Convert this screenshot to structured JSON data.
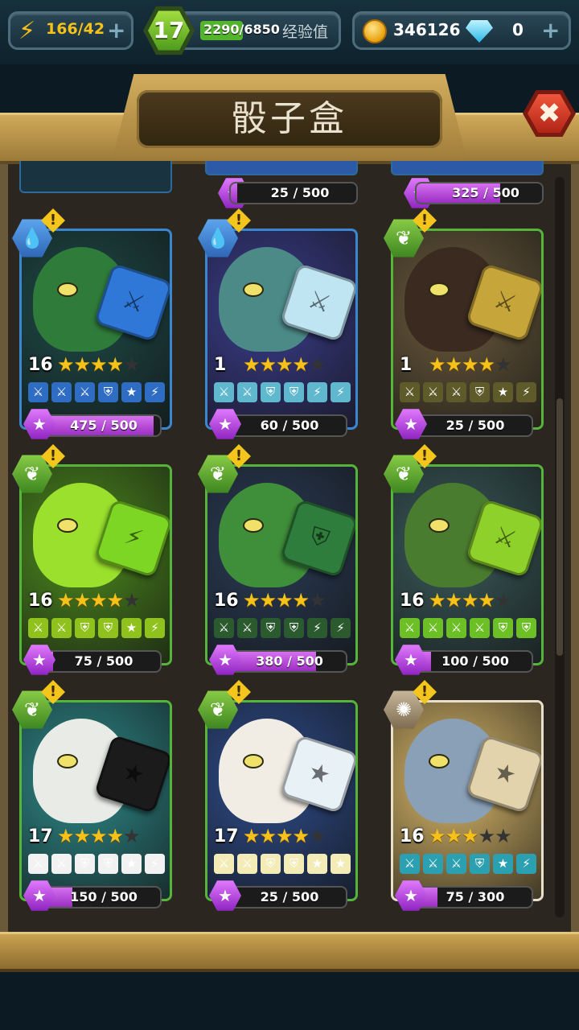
{
  "header": {
    "energy": "166/42",
    "level": "17",
    "xp": "2290/6850",
    "xp_progress": 0.33,
    "xp_label": "经验值",
    "coins": "346126",
    "gems": "0",
    "plus_label": "+"
  },
  "title": "骰子盒",
  "close_label": "✖",
  "partial_row": [
    {
      "progress": "25 / 500"
    },
    {
      "progress": "325 / 500"
    }
  ],
  "cards": [
    {
      "element": "water",
      "element_icon": "💧",
      "level": "16",
      "stars": 4,
      "progress": "475 / 500",
      "progress_ratio": 0.95,
      "bg": "#1d4a48",
      "creature": "#2f7c3a",
      "die": "#2f78d8",
      "die_face": "⚔",
      "face_color": "#2f6cc4",
      "faces": [
        "⚔",
        "⚔",
        "⚔",
        "⛨",
        "★",
        "⚡"
      ]
    },
    {
      "element": "water",
      "element_icon": "💧",
      "level": "1",
      "stars": 4,
      "progress": "60 / 500",
      "progress_ratio": 0.12,
      "bg": "#3a3d8c",
      "creature": "#4c8a88",
      "die": "#bfe4f2",
      "die_face": "⚔",
      "face_color": "#60b8cf",
      "faces": [
        "⚔",
        "⚔",
        "⛨",
        "⛨",
        "⚡",
        "⚡"
      ]
    },
    {
      "element": "nature",
      "element_icon": "❦",
      "level": "1",
      "stars": 4,
      "progress": "25 / 500",
      "progress_ratio": 0.05,
      "bg": "#6a5a3c",
      "creature": "#3a2a20",
      "die": "#c6a53a",
      "die_face": "⚔",
      "face_color": "#5f5a2a",
      "faces": [
        "⚔",
        "⚔",
        "⚔",
        "⛨",
        "★",
        "⚡"
      ]
    },
    {
      "element": "nature",
      "element_icon": "❦",
      "level": "16",
      "stars": 4,
      "progress": "75 / 500",
      "progress_ratio": 0.15,
      "bg": "#4c8a1e",
      "creature": "#9ae02c",
      "die": "#7ed624",
      "die_face": "⚡",
      "face_color": "#8fc21c",
      "faces": [
        "⚔",
        "⚔",
        "⛨",
        "⛨",
        "★",
        "⚡"
      ]
    },
    {
      "element": "nature",
      "element_icon": "❦",
      "level": "16",
      "stars": 4,
      "progress": "380 / 500",
      "progress_ratio": 0.76,
      "bg": "#2a3c56",
      "creature": "#3f8f3a",
      "die": "#2f7d3c",
      "die_face": "⛨",
      "face_color": "#2a5a2e",
      "faces": [
        "⚔",
        "⚔",
        "⛨",
        "⛨",
        "⚡",
        "⚡"
      ]
    },
    {
      "element": "nature",
      "element_icon": "❦",
      "level": "16",
      "stars": 4,
      "progress": "100 / 500",
      "progress_ratio": 0.2,
      "bg": "#3a5a5a",
      "creature": "#4a7c30",
      "die": "#8ed12a",
      "die_face": "⚔",
      "face_color": "#6cbf24",
      "faces": [
        "⚔",
        "⚔",
        "⚔",
        "⚔",
        "⛨",
        "⛨"
      ]
    },
    {
      "element": "nature",
      "element_icon": "❦",
      "level": "17",
      "stars": 4,
      "progress": "150 / 500",
      "progress_ratio": 0.3,
      "bg": "#2e8a8a",
      "creature": "#e9ece6",
      "die": "#1b1b1b",
      "die_face": "★",
      "face_color": "#f2f2f2",
      "faces": [
        "⚔",
        "⚔",
        "⛨",
        "⛨",
        "★",
        "⚡"
      ]
    },
    {
      "element": "nature",
      "element_icon": "❦",
      "level": "17",
      "stars": 4,
      "progress": "25 / 500",
      "progress_ratio": 0.05,
      "bg": "#2e4c8a",
      "creature": "#f2ede4",
      "die": "#e8f2f6",
      "die_face": "★",
      "face_color": "#f3ecb6",
      "faces": [
        "⚔",
        "⚔",
        "⛨",
        "⛨",
        "★",
        "★"
      ]
    },
    {
      "element": "legend",
      "element_icon": "✺",
      "level": "16",
      "stars": 3,
      "progress": "75 / 300",
      "progress_ratio": 0.25,
      "bg": "#d9b86a",
      "creature": "#8aa0b6",
      "die": "#e2d3ad",
      "die_face": "★",
      "face_color": "#2aa0b0",
      "faces": [
        "⚔",
        "⚔",
        "⚔",
        "⛨",
        "★",
        "⚡"
      ]
    }
  ],
  "warn_label": "!"
}
